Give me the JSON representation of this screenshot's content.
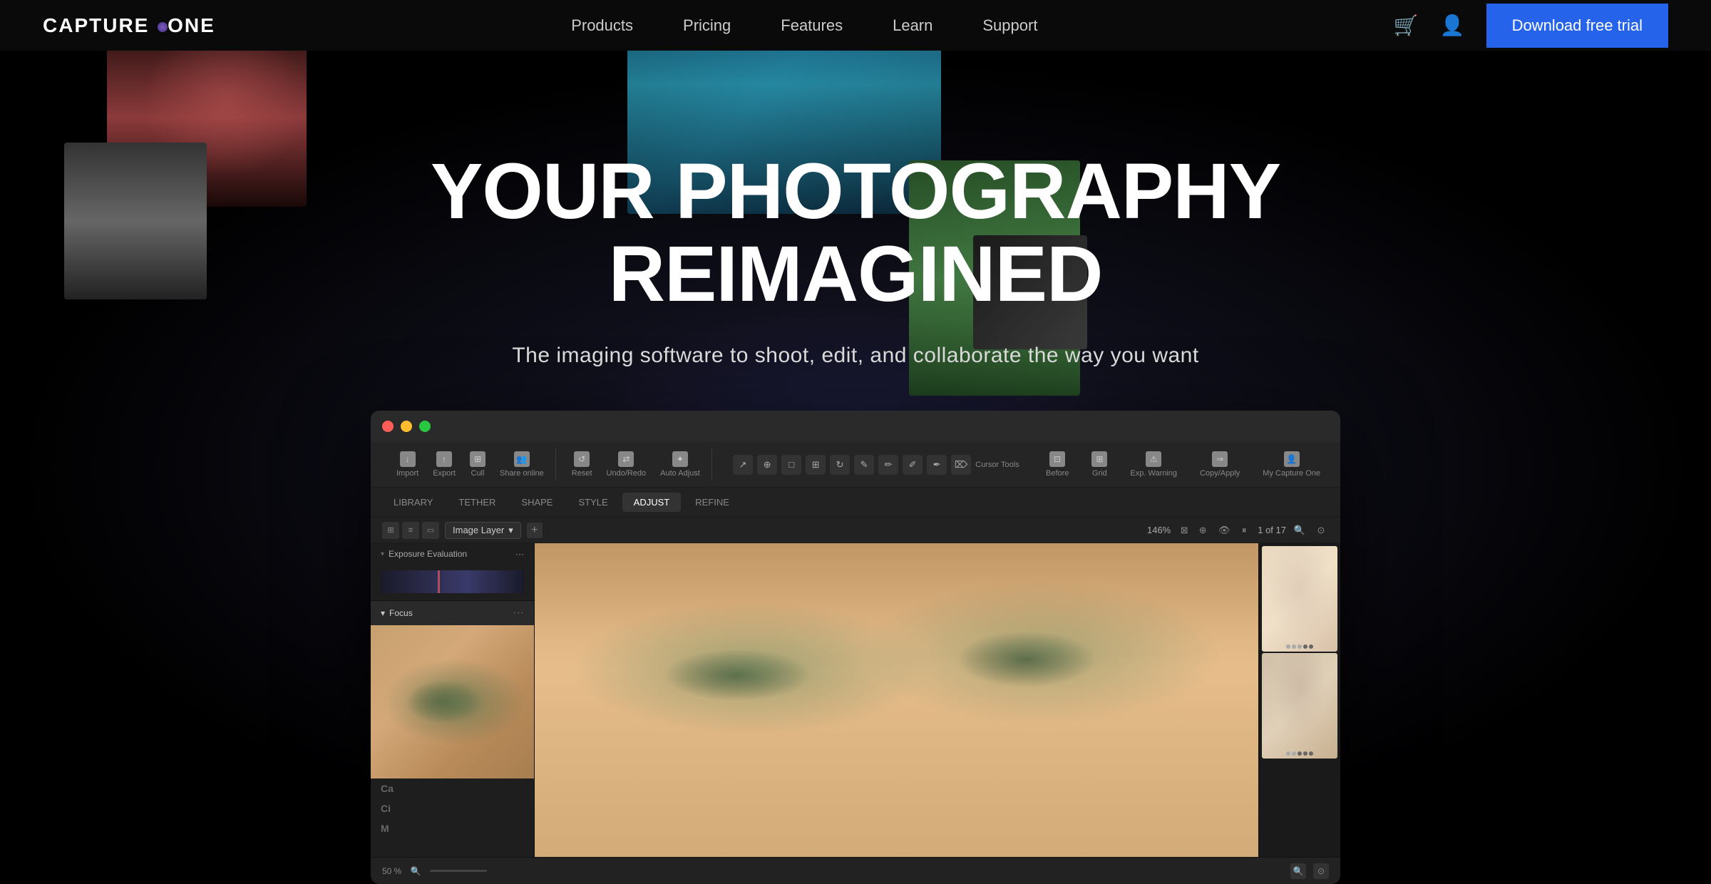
{
  "nav": {
    "logo": "CAPTURE ONE",
    "logo_dot": "●",
    "links": [
      {
        "label": "Products",
        "id": "products"
      },
      {
        "label": "Pricing",
        "id": "pricing"
      },
      {
        "label": "Features",
        "id": "features"
      },
      {
        "label": "Learn",
        "id": "learn"
      },
      {
        "label": "Support",
        "id": "support"
      }
    ],
    "cta": "Download free trial",
    "cart_icon": "🛒",
    "account_icon": "👤"
  },
  "hero": {
    "title_line1": "YOUR PHOTOGRAPHY",
    "title_line2": "REIMAGINED",
    "subtitle": "The imaging software to shoot, edit, and collaborate the way you want"
  },
  "app": {
    "toolbar": {
      "import": "Import",
      "export": "Export",
      "cull": "Cull",
      "share_online": "Share online",
      "reset": "Reset",
      "undo_redo": "Undo/Redo",
      "auto_adjust": "Auto Adjust",
      "cursor_tools": "Cursor Tools",
      "before": "Before",
      "grid": "Grid",
      "exp_warning": "Exp. Warning",
      "copy_apply": "Copy/Apply",
      "my_capture_one": "My Capture One"
    },
    "tabs": {
      "library": "LIBRARY",
      "tether": "TETHER",
      "shape": "SHAPE",
      "style": "STYLE",
      "adjust": "ADJUST",
      "refine": "REFINE"
    },
    "layer_bar": {
      "layer_name": "Image Layer",
      "zoom_level": "146%"
    },
    "panels": {
      "exposure_evaluation": "Exposure Evaluation",
      "focus": "Focus",
      "items": [
        "Ca",
        "Ci",
        "M"
      ]
    },
    "zoom_bottom": "50 %",
    "page_counter": "1 of 17"
  }
}
